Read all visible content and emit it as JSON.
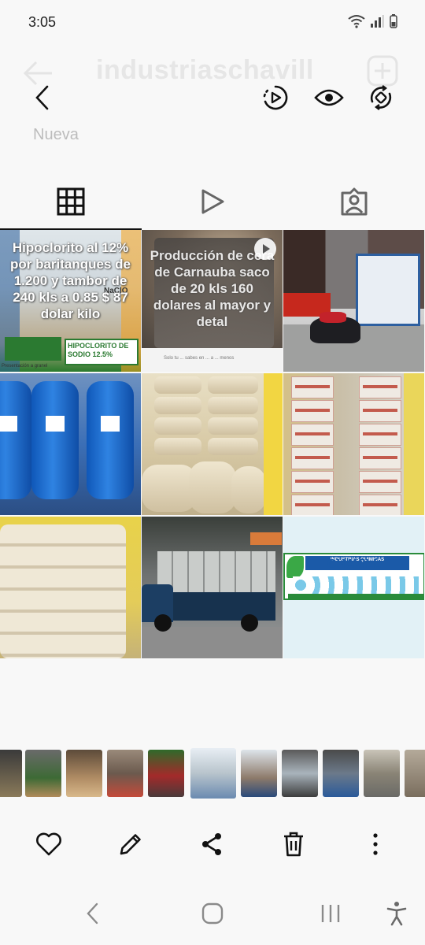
{
  "status_bar": {
    "time": "3:05"
  },
  "background": {
    "title": "industriaschavill",
    "nueva_label": "Nueva"
  },
  "top_actions": {
    "icons": [
      "back-arrow-icon",
      "motion-photo-icon",
      "eye-icon",
      "remaster-icon"
    ]
  },
  "profile_tabs": [
    "grid-tab",
    "reels-tab",
    "tagged-tab"
  ],
  "posts": {
    "hipoclorito": {
      "overlay": "Hipoclorito al 12% por baritanques de 1.200 y tambor de 240 kls a 0.85 $ 87 dolar kilo",
      "badge": "NaClO",
      "ribbon": "HIPOCLORITO DE SODIO 12.5%",
      "footer": "Presentación a granel"
    },
    "carnauba": {
      "overlay": "Producción de cera de Carnauba saco de 20 kls 160 dolares al mayor y detal",
      "caption": "Solo tu ... sabes  en ... a ... menos"
    },
    "chavill_banner": {
      "title": "INDUSTRIAS QUIMICAS",
      "brand": "CHAVILL"
    }
  },
  "filmstrip": {
    "count": 11,
    "selected_index": 5
  },
  "bottom_actions": {
    "icons": [
      "heart-icon",
      "pencil-icon",
      "share-icon",
      "trash-icon",
      "more-vertical-icon"
    ]
  },
  "colors": {
    "background": "#f8f8f8",
    "icon": "#111111",
    "nav_icon": "#8a8a8a"
  }
}
